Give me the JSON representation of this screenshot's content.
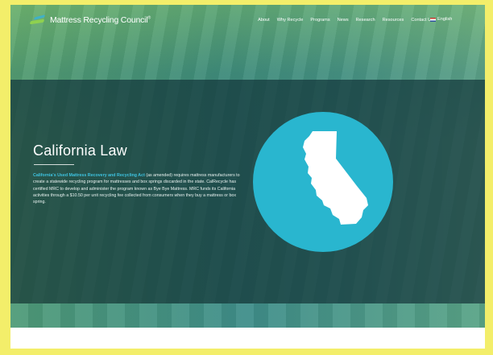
{
  "brand": {
    "name": "Mattress Recycling Council",
    "trademark": "®"
  },
  "nav": {
    "items": [
      {
        "label": "About"
      },
      {
        "label": "Why Recycle"
      },
      {
        "label": "Programs"
      },
      {
        "label": "News"
      },
      {
        "label": "Research"
      },
      {
        "label": "Resources"
      },
      {
        "label": "Contact Us"
      }
    ],
    "language": "English"
  },
  "hero": {
    "title": "California Law",
    "link_text": "California's Used Mattress Recovery and Recycling Act",
    "body_text": " (as amended) requires mattress manufacturers to create a statewide recycling program for mattresses and box springs discarded in the state. CalRecycle has certified MRC to develop and administer the program known as Bye Bye Mattress. MRC funds its California activities through a $10.50 per unit recycling fee collected from consumers when they buy a mattress or box spring."
  },
  "colors": {
    "accent_blue": "#29b6cf",
    "link_blue": "#3ec3e0",
    "logo_green": "#8fd14f",
    "page_border": "#f3ee6a"
  },
  "icons": {
    "map": "california-map-icon",
    "flag": "us-flag-icon",
    "logo": "mrc-logo-icon"
  }
}
